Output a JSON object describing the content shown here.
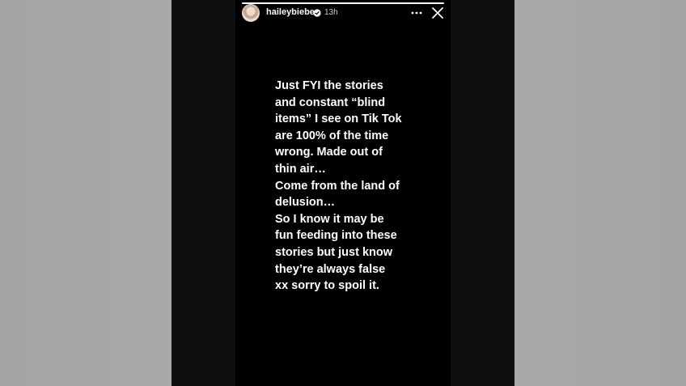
{
  "colors": {
    "background_gray": "#a6a6a6",
    "story_background": "#000000",
    "text": "#ffffff",
    "verified_badge": "#ffffff"
  },
  "header": {
    "username": "haileybieber",
    "timestamp": "13h",
    "verified_icon": "verified-badge-icon",
    "more_icon": "more-horizontal-icon",
    "close_icon": "close-icon"
  },
  "progress": {
    "fraction": 1.0
  },
  "story": {
    "lines": [
      "Just FYI the stories",
      "and constant “blind",
      "items” I see on Tik Tok",
      "are 100% of the time",
      "wrong. Made out of",
      "thin air…",
      "Come from the land of",
      "delusion…",
      "So I know it may be",
      "fun feeding into these",
      "stories but just know",
      "they’re always false",
      "xx sorry to spoil it."
    ]
  }
}
